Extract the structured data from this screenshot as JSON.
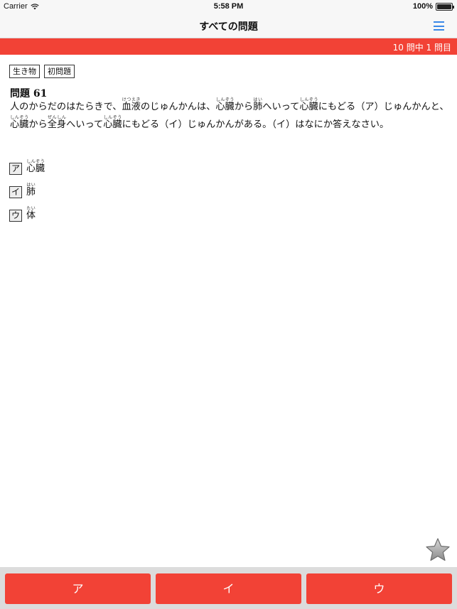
{
  "status": {
    "carrier": "Carrier",
    "time": "5:58 PM",
    "battery": "100%"
  },
  "nav": {
    "title": "すべての問題"
  },
  "progress": {
    "text": "10 問中 1 問目"
  },
  "tags": [
    "生き物",
    "初問題"
  ],
  "question": {
    "title": "問題 61",
    "p1": "人のからだのはたらきで、",
    "k_blood": "血",
    "r_blood": "けつ",
    "k_liquid": "液",
    "r_liquid": "えき",
    "p2": "のじゅんかんは、",
    "k_heart1": "心臓",
    "r_heart1": "しんぞう",
    "p3": "から",
    "k_lung": "肺",
    "r_lung": "はい",
    "p4": "へいって",
    "k_heart2": "心臓",
    "r_heart2": "しんぞう",
    "p5": "にもどる（ア）じゅんかんと、",
    "k_heart3": "心臓",
    "r_heart3": "しんぞう",
    "p6": "から",
    "k_body": "全身",
    "r_body": "ぜんしん",
    "p7": "へいって",
    "k_heart4": "心臓",
    "r_heart4": "しんぞう",
    "p8": "にもどる（イ）じゅんかんがある。（イ）はなにか答えなさい。"
  },
  "choices": [
    {
      "key": "ア",
      "text": "心臓",
      "ruby": "しんぞう"
    },
    {
      "key": "イ",
      "text": "肺",
      "ruby": "はい"
    },
    {
      "key": "ウ",
      "text": "体",
      "ruby": "たい"
    }
  ],
  "answers": [
    "ア",
    "イ",
    "ウ"
  ],
  "colors": {
    "accent": "#f24236",
    "link": "#3a88e8"
  }
}
